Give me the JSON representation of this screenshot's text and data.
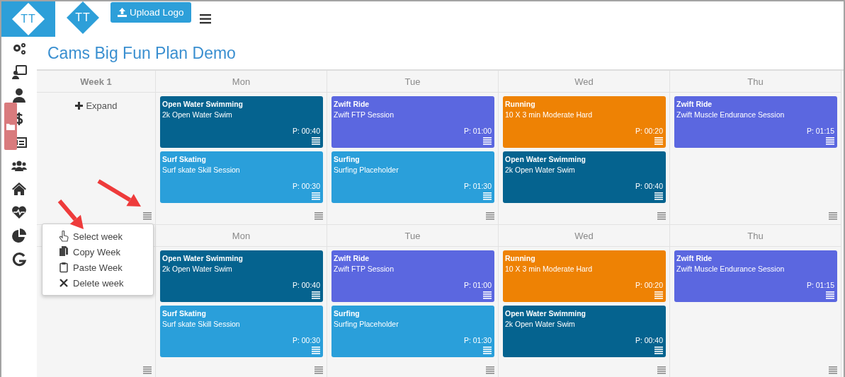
{
  "header": {
    "logo_text": "TT",
    "brand_text": "TT",
    "upload_button": "Upload Logo"
  },
  "title": "Cams Big Fun Plan Demo",
  "weeks": [
    {
      "label": "Week 1",
      "expand": "Expand",
      "days": [
        {
          "name": "Mon",
          "workouts": [
            {
              "sport": "Open Water Swimming",
              "session": "2k Open Water Swim",
              "planned": "P: 00:40",
              "color": "#05638f"
            },
            {
              "sport": "Surf Skating",
              "session": "Surf skate Skill Session",
              "planned": "P: 00:30",
              "color": "#2a9fda"
            }
          ]
        },
        {
          "name": "Tue",
          "workouts": [
            {
              "sport": "Zwift Ride",
              "session": "Zwift FTP Session",
              "planned": "P: 01:00",
              "color": "#5b67e0"
            },
            {
              "sport": "Surfing",
              "session": "Surfing Placeholder",
              "planned": "P: 01:30",
              "color": "#2a9fda"
            }
          ]
        },
        {
          "name": "Wed",
          "workouts": [
            {
              "sport": "Running",
              "session": "10 X 3 min Moderate Hard",
              "planned": "P: 00:20",
              "color": "#ee8204"
            },
            {
              "sport": "Open Water Swimming",
              "session": "2k Open Water Swim",
              "planned": "P: 00:40",
              "color": "#05638f"
            }
          ]
        },
        {
          "name": "Thu",
          "workouts": [
            {
              "sport": "Zwift Ride",
              "session": "Zwift Muscle Endurance Session",
              "planned": "P: 01:15",
              "color": "#5b67e0"
            }
          ]
        }
      ]
    },
    {
      "days": [
        {
          "name": "Mon",
          "workouts": [
            {
              "sport": "Open Water Swimming",
              "session": "2k Open Water Swim",
              "planned": "P: 00:40",
              "color": "#05638f"
            },
            {
              "sport": "Surf Skating",
              "session": "Surf skate Skill Session",
              "planned": "P: 00:30",
              "color": "#2a9fda"
            }
          ]
        },
        {
          "name": "Tue",
          "workouts": [
            {
              "sport": "Zwift Ride",
              "session": "Zwift FTP Session",
              "planned": "P: 01:00",
              "color": "#5b67e0"
            },
            {
              "sport": "Surfing",
              "session": "Surfing Placeholder",
              "planned": "P: 01:30",
              "color": "#2a9fda"
            }
          ]
        },
        {
          "name": "Wed",
          "workouts": [
            {
              "sport": "Running",
              "session": "10 X 3 min Moderate Hard",
              "planned": "P: 00:20",
              "color": "#ee8204"
            },
            {
              "sport": "Open Water Swimming",
              "session": "2k Open Water Swim",
              "planned": "P: 00:40",
              "color": "#05638f"
            }
          ]
        },
        {
          "name": "Thu",
          "workouts": [
            {
              "sport": "Zwift Ride",
              "session": "Zwift Muscle Endurance Session",
              "planned": "P: 01:15",
              "color": "#5b67e0"
            }
          ]
        }
      ]
    }
  ],
  "context_menu": {
    "items": [
      {
        "kind": "select",
        "label": "Select week"
      },
      {
        "kind": "copy",
        "label": "Copy Week"
      },
      {
        "kind": "paste",
        "label": "Paste Week"
      },
      {
        "kind": "delete",
        "label": "Delete week"
      }
    ]
  }
}
